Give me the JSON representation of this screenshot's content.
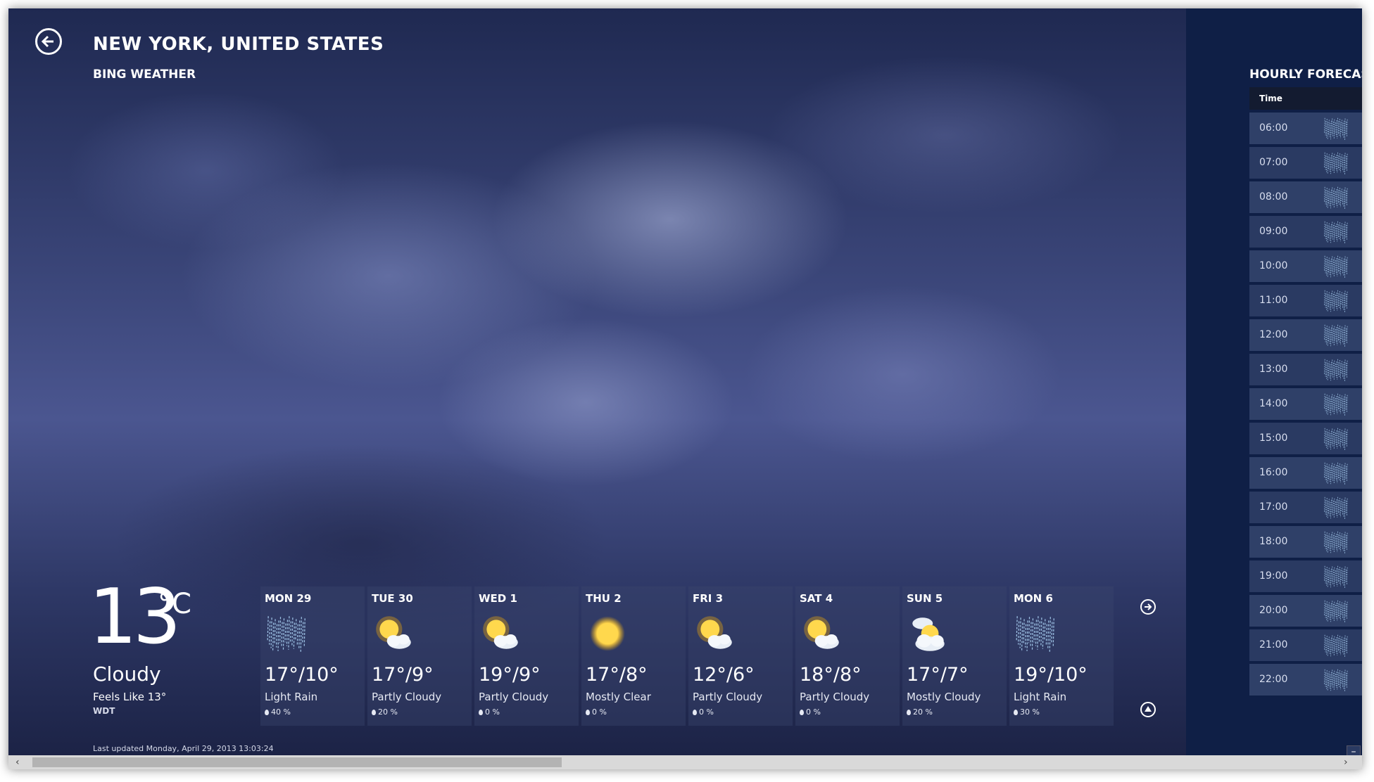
{
  "header": {
    "location": "NEW YORK, UNITED STATES",
    "app_name": "BING WEATHER"
  },
  "current": {
    "temperature": "13",
    "unit": "°C",
    "condition": "Cloudy",
    "feels_like": "Feels Like 13°",
    "source": "WDT",
    "last_updated": "Last updated Monday, April 29, 2013 13:03:24"
  },
  "daily": [
    {
      "day": "MON 29",
      "temps": "17°/10°",
      "condition": "Light Rain",
      "precip": "40 %",
      "icon": "rain-icon"
    },
    {
      "day": "TUE 30",
      "temps": "17°/9°",
      "condition": "Partly Cloudy",
      "precip": "20 %",
      "icon": "partly-cloudy-icon"
    },
    {
      "day": "WED 1",
      "temps": "19°/9°",
      "condition": "Partly Cloudy",
      "precip": "0 %",
      "icon": "partly-cloudy-icon"
    },
    {
      "day": "THU 2",
      "temps": "17°/8°",
      "condition": "Mostly Clear",
      "precip": "0 %",
      "icon": "sun-icon"
    },
    {
      "day": "FRI 3",
      "temps": "12°/6°",
      "condition": "Partly Cloudy",
      "precip": "0 %",
      "icon": "partly-cloudy-icon"
    },
    {
      "day": "SAT 4",
      "temps": "18°/8°",
      "condition": "Partly Cloudy",
      "precip": "0 %",
      "icon": "partly-cloudy-icon"
    },
    {
      "day": "SUN 5",
      "temps": "17°/7°",
      "condition": "Mostly Cloudy",
      "precip": "20 %",
      "icon": "mostly-cloudy-icon"
    },
    {
      "day": "MON 6",
      "temps": "19°/10°",
      "condition": "Light Rain",
      "precip": "30 %",
      "icon": "rain-icon"
    }
  ],
  "hourly": {
    "title": "HOURLY FORECAST",
    "column_header": "Time",
    "rows": [
      "06:00",
      "07:00",
      "08:00",
      "09:00",
      "10:00",
      "11:00",
      "12:00",
      "13:00",
      "14:00",
      "15:00",
      "16:00",
      "17:00",
      "18:00",
      "19:00",
      "20:00",
      "21:00",
      "22:00"
    ]
  }
}
